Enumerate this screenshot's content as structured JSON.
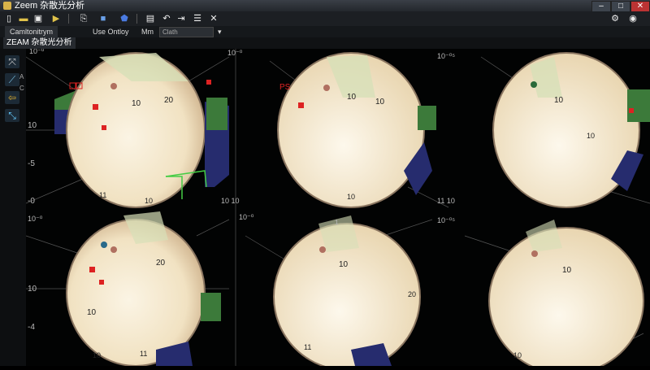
{
  "window": {
    "title": "Zeem 杂散光分析"
  },
  "toolbar": {
    "icons": [
      "new-file-icon",
      "open-folder-icon",
      "save-icon",
      "run-icon",
      "copy-icon",
      "layers-icon",
      "shield-icon",
      "document-icon",
      "undo-icon",
      "redo-icon",
      "list-icon",
      "close-icon"
    ]
  },
  "menubar": {
    "tab_label": "Camltonitrym",
    "menu1": "Use Ontloy",
    "menu2": "Mm",
    "field_value": "Clath"
  },
  "tabbar": {
    "active_tab": "ZEAM 杂散光分析"
  },
  "lefttools": {
    "label_a": "A",
    "label_b": "C"
  },
  "plots": {
    "labels_10": "10",
    "labels_20": "20",
    "labels_11": "11",
    "label_1": "1",
    "axis_top": "10⁻⁰",
    "axis_10": "10",
    "axis_neg5": "-5",
    "axis_neg0": "-0",
    "axis_neg4": "-4",
    "axis_1010": "10 10",
    "axis_top2": "10⁻⁰⁵",
    "axis_110": "11 10",
    "ps": "PS"
  },
  "colors": {
    "plot_fill": "#f2e4c8",
    "green": "#3c7a3a",
    "navy": "#262c6e",
    "red": "#d22",
    "bg": "#020303"
  }
}
